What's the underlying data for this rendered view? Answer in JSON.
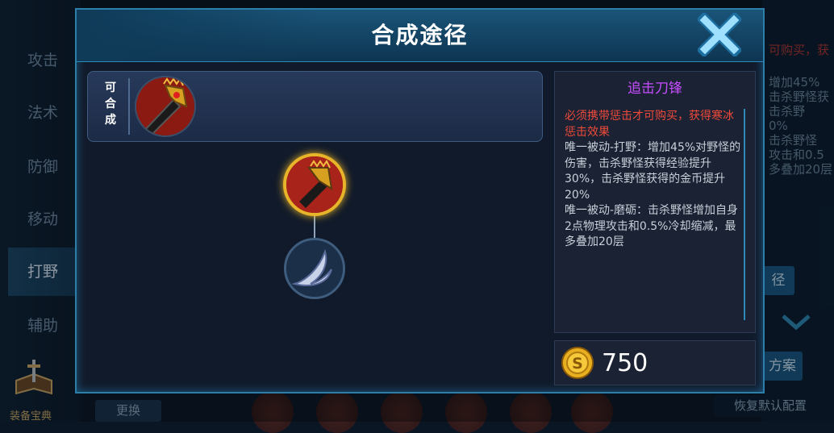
{
  "background": {
    "sidebar": [
      "攻击",
      "法术",
      "防御",
      "移动",
      "打野",
      "辅助"
    ],
    "sidebar_active": "打野",
    "book_label": "装备宝典",
    "swap_button": "更换",
    "right_texts": [
      "可购买，获",
      "增加45%",
      "击杀野怪获",
      "击杀野",
      "0%",
      "击杀野怪",
      "攻击和0.5",
      "多叠加20层"
    ],
    "right_button": "径",
    "scheme_button": "方案",
    "restore_button": "恢复默认配置"
  },
  "dialog": {
    "title": "合成途径",
    "combine_label": [
      "可",
      "合",
      "成"
    ],
    "item": {
      "name": "追击刀锋",
      "requirement": "必须携带惩击才可购买，获得寒冰惩击效果",
      "passive1": "唯一被动-打野：增加45%对野怪的伤害，击杀野怪获得经验提升30%，击杀野怪获得的金币提升20%",
      "passive2": "唯一被动-磨砺：击杀野怪增加自身2点物理攻击和0.5%冷却缩减，最多叠加20层",
      "price": "750"
    }
  },
  "icons": {
    "close": "close-x-icon",
    "coin": "gold-coin-icon",
    "root_item": "chasing-blade-icon",
    "child_item": "hunting-blade-icon",
    "combine_item": "red-crowned-blade-icon"
  },
  "colors": {
    "accent": "#2e8ab8",
    "item_name": "#c64dff",
    "requirement": "#f04a3a",
    "selected_ring": "#e8b42a"
  }
}
